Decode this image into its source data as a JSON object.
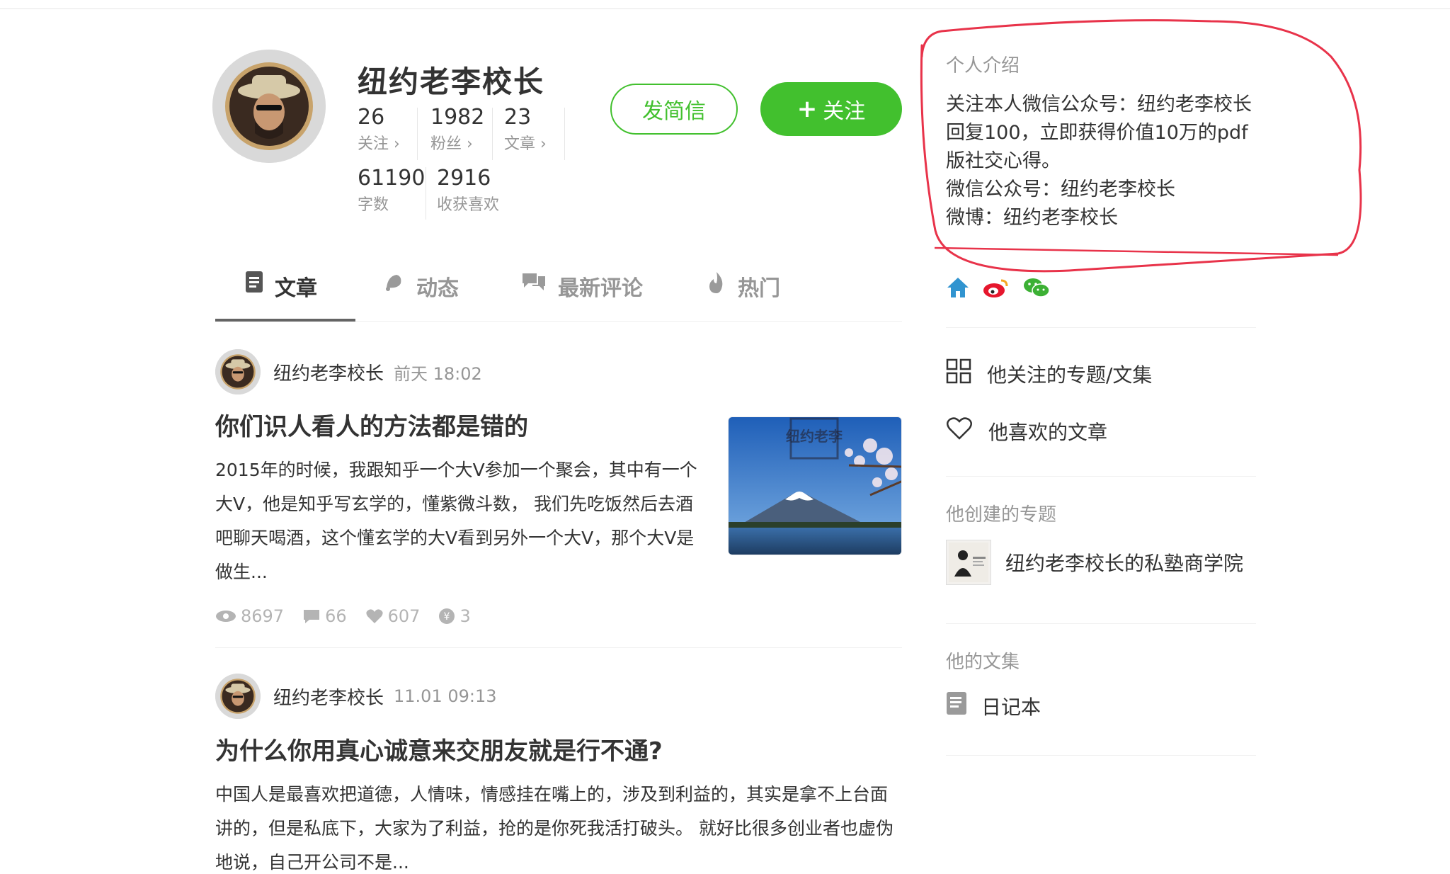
{
  "profile": {
    "name": "纽约老李校长",
    "stats_row1": [
      {
        "num": "26",
        "label": "关注 ›"
      },
      {
        "num": "1982",
        "label": "粉丝 ›"
      },
      {
        "num": "23",
        "label": "文章 ›"
      }
    ],
    "stats_row2": [
      {
        "num": "61190",
        "label": "字数"
      },
      {
        "num": "2916",
        "label": "收获喜欢"
      }
    ],
    "message_button": "发简信",
    "follow_button": "关注",
    "follow_plus": "+"
  },
  "tabs": [
    {
      "label": "文章",
      "icon": "document-icon",
      "active": true
    },
    {
      "label": "动态",
      "icon": "bell-icon",
      "active": false
    },
    {
      "label": "最新评论",
      "icon": "comments-icon",
      "active": false
    },
    {
      "label": "热门",
      "icon": "flame-icon",
      "active": false
    }
  ],
  "articles": [
    {
      "author": "纽约老李校长",
      "time": "前天 18:02",
      "title": "你们识人看人的方法都是错的",
      "abstract": "2015年的时候，我跟知乎一个大V参加一个聚会，其中有一个大V，他是知乎写玄学的，懂紫微斗数， 我们先吃饭然后去酒吧聊天喝酒，这个懂玄学的大V看到另外一个大V，那个大V是做生...",
      "views": "8697",
      "comments": "66",
      "likes": "607",
      "rewards": "3",
      "thumb_watermark": "纽约老李"
    },
    {
      "author": "纽约老李校长",
      "time": "11.01 09:13",
      "title": "为什么你用真心诚意来交朋友就是行不通?",
      "abstract": "中国人是最喜欢把道德，人情味，情感挂在嘴上的，涉及到利益的，其实是拿不上台面讲的，但是私底下，大家为了利益，抢的是你死我活打破头。 就好比很多创业者也虚伪地说，自己开公司不是..."
    }
  ],
  "sidebar": {
    "intro_title": "个人介绍",
    "intro_lines": [
      "关注本人微信公众号：纽约老李校长",
      "回复100，立即获得价值10万的pdf版社交心得。",
      "微信公众号：纽约老李校长",
      "微博：纽约老李校长"
    ],
    "links": [
      {
        "label": "他关注的专题/文集",
        "icon": "grid-icon"
      },
      {
        "label": "他喜欢的文章",
        "icon": "heart-icon"
      }
    ],
    "created_heading": "他创建的专题",
    "created_collection": "纽约老李校长的私塾商学院",
    "notebooks_heading": "他的文集",
    "notebook": "日记本"
  },
  "colors": {
    "accent_green": "#42c02e",
    "annotation_red": "#e8334a",
    "muted": "#969696"
  }
}
